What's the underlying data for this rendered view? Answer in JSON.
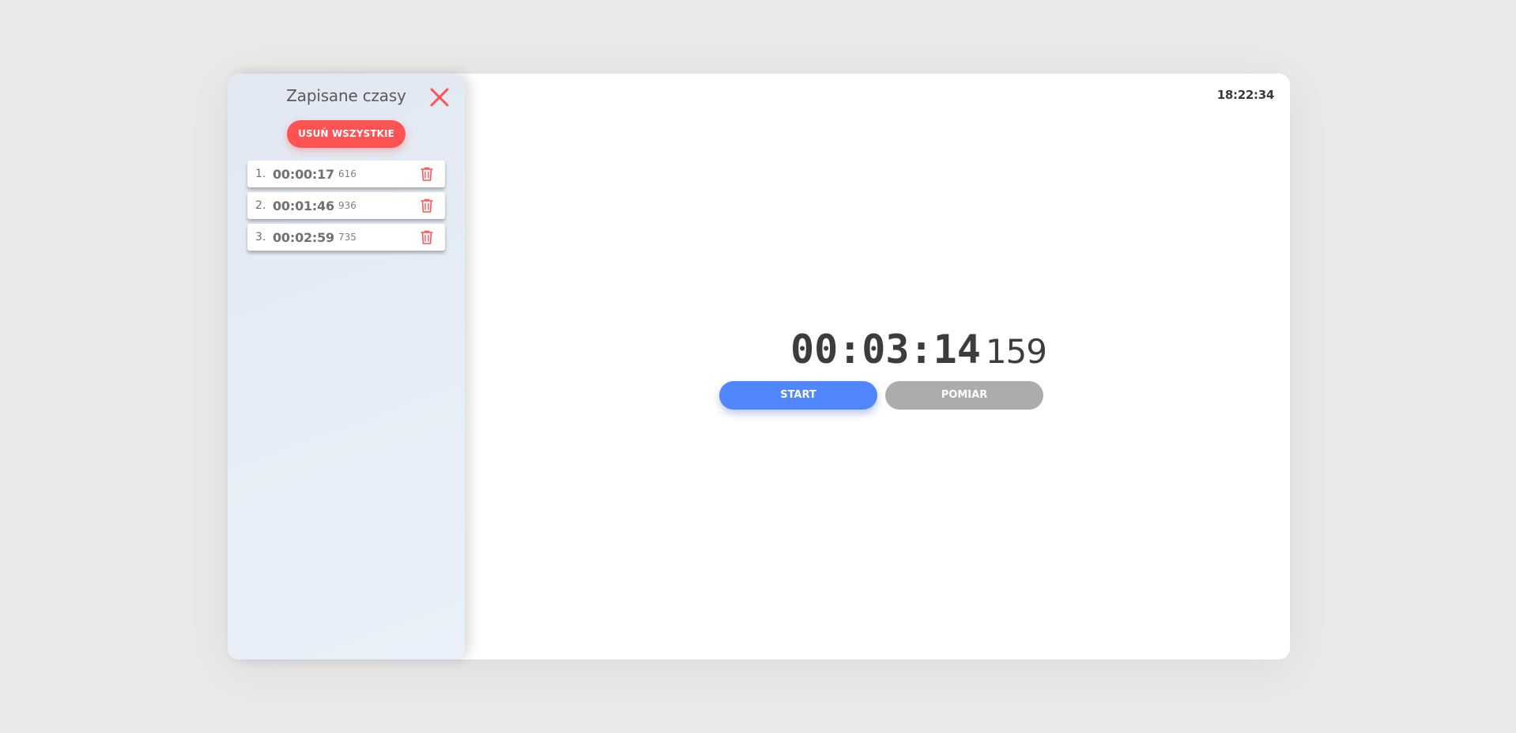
{
  "sidebar": {
    "title": "Zapisane czasy",
    "close_icon": "close-icon",
    "delete_all_label": "USUŃ WSZYSTKIE",
    "items": [
      {
        "index": "1.",
        "time": "00:00:17",
        "ms": "616"
      },
      {
        "index": "2.",
        "time": "00:01:46",
        "ms": "936"
      },
      {
        "index": "3.",
        "time": "00:02:59",
        "ms": "735"
      }
    ]
  },
  "clock": "18:22:34",
  "timer": {
    "main": "00:03:14",
    "ms": "159"
  },
  "buttons": {
    "start_label": "START",
    "measure_label": "POMIAR"
  },
  "colors": {
    "accent_red": "#ff5353",
    "start_blue": "#5087ff",
    "measure_gray": "#acacac",
    "background": "#e9e9e9"
  }
}
